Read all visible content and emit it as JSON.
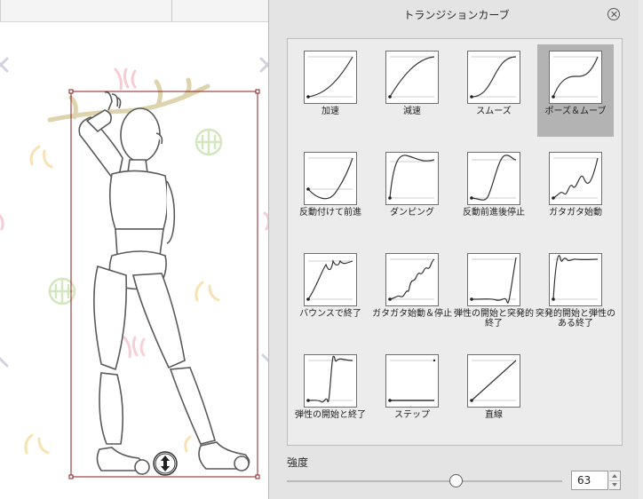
{
  "dialog": {
    "title": "トランジションカーブ",
    "close_icon": "close-circle-icon"
  },
  "presets": [
    {
      "id": "accel",
      "label": "加速",
      "selected": false
    },
    {
      "id": "decel",
      "label": "減速",
      "selected": false
    },
    {
      "id": "smooth",
      "label": "スムーズ",
      "selected": false
    },
    {
      "id": "pause-move",
      "label": "ポーズ＆ムーブ",
      "selected": true
    },
    {
      "id": "anticipate",
      "label": "反動付けて前進",
      "selected": false
    },
    {
      "id": "damping",
      "label": "ダンピング",
      "selected": false
    },
    {
      "id": "recoil-stop",
      "label": "反動前進後停止",
      "selected": false
    },
    {
      "id": "rattle-start",
      "label": "ガタガタ始動",
      "selected": false
    },
    {
      "id": "bounce-end",
      "label": "バウンスで終了",
      "selected": false
    },
    {
      "id": "rattle-start-stop",
      "label": "ガタガタ始動＆停止",
      "selected": false
    },
    {
      "id": "elastic-start-sudden",
      "label": "弾性の開始と突発的終了",
      "selected": false
    },
    {
      "id": "sudden-start-elastic",
      "label": "突発的開始と弾性のある終了",
      "selected": false
    },
    {
      "id": "elastic-start-end",
      "label": "弾性の開始と終了",
      "selected": false
    },
    {
      "id": "step",
      "label": "ステップ",
      "selected": false
    },
    {
      "id": "linear",
      "label": "直線",
      "selected": false
    }
  ],
  "strength": {
    "label": "強度",
    "value": "63",
    "slider_fraction": 0.63
  },
  "colors": {
    "selected_bg": "#b3b3b3",
    "bbox_outline": "#8b1c1c",
    "curve": "#333333"
  },
  "canvas": {
    "move_icon": "vertical-move-icon"
  }
}
